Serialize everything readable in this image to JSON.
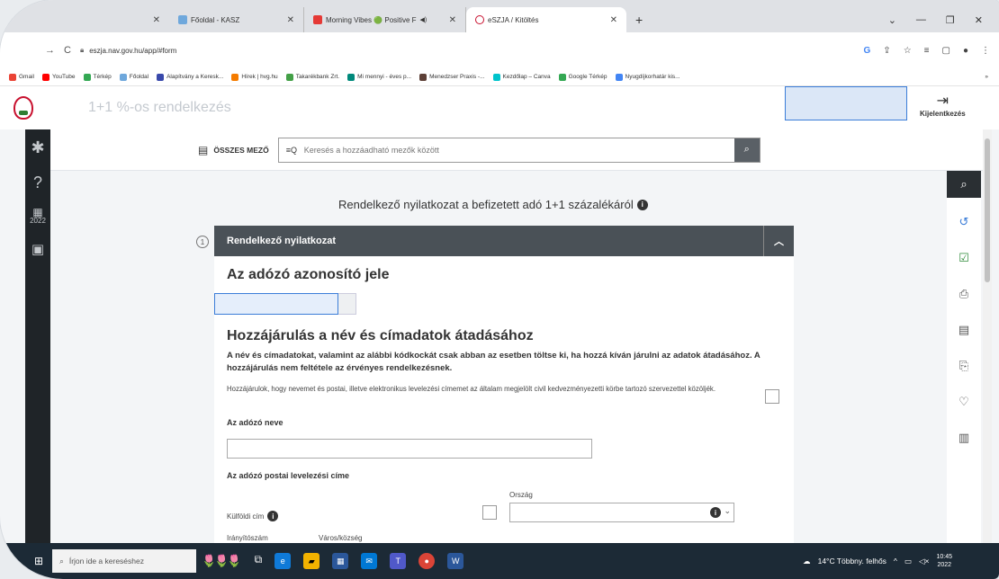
{
  "browser": {
    "tabs": [
      {
        "label": "Főoldal - KASZ",
        "color": "#6fa8dc"
      },
      {
        "label": "Morning Vibes 🟢 Positive F",
        "color": "#e53935",
        "audio": "🔊"
      },
      {
        "label": "eSZJA / Kitöltés",
        "color": "#c8102e",
        "active": true
      }
    ],
    "new_tab": "+",
    "url": "eszja.nav.gov.hu/app/#form",
    "bookmarks": [
      {
        "label": "Gmail",
        "color": "#ea4335"
      },
      {
        "label": "YouTube",
        "color": "#ff0000"
      },
      {
        "label": "Térkép",
        "color": "#34a853"
      },
      {
        "label": "Főoldal",
        "color": "#6fa8dc"
      },
      {
        "label": "Alapítvány a Keresk...",
        "color": "#3949ab"
      },
      {
        "label": "Hírek | hvg.hu",
        "color": "#f57c00"
      },
      {
        "label": "Takarékbank Zrt.",
        "color": "#43a047"
      },
      {
        "label": "Mi mennyi - éves p...",
        "color": "#00897b"
      },
      {
        "label": "Menedzser Praxis -...",
        "color": "#5d4037"
      },
      {
        "label": "Kezdőlap – Canva",
        "color": "#00c4cc"
      },
      {
        "label": "Google Térkép",
        "color": "#34a853"
      },
      {
        "label": "Nyugdíjkorhatár kis...",
        "color": "#4285f4"
      }
    ]
  },
  "app": {
    "title": "1+1 %-os rendelkezés",
    "logout_label": "Kijelentkezés",
    "year": "2022"
  },
  "search": {
    "all_fields_label": "ÖSSZES MEZŐ",
    "placeholder": "Keresés a hozzáadható mezők között"
  },
  "form": {
    "doc_title": "Rendelkező nyilatkozat a befizetett adó 1+1 százalékáról",
    "step_number": "1",
    "section_title": "Rendelkező nyilatkozat",
    "taxpayer_id_heading": "Az adózó azonosító jele",
    "consent_heading": "Hozzájárulás a név és címadatok átadásához",
    "consent_bold": "A név és címadatokat, valamint az alábbi kódkockát csak abban az esetben töltse ki, ha hozzá kíván járulni az adatok átadásához. A hozzájárulás nem feltétele az érvényes rendelkezésnek.",
    "consent_text": "Hozzájárulok, hogy nevemet és postai, illetve elektronikus levelezési címemet az általam megjelölt civil kedvezményezetti körbe tartozó szervezettel közöljék.",
    "name_label": "Az adózó neve",
    "address_label": "Az adózó postai levelezési címe",
    "country_label": "Ország",
    "foreign_label": "Külföldi cím",
    "zip_label": "Irányítószám",
    "city_label": "Város/község"
  },
  "taskbar": {
    "search_placeholder": "Írjon ide a kereséshez",
    "weather": "14°C Többny. felhős",
    "time": "10:45",
    "date": "2022"
  }
}
